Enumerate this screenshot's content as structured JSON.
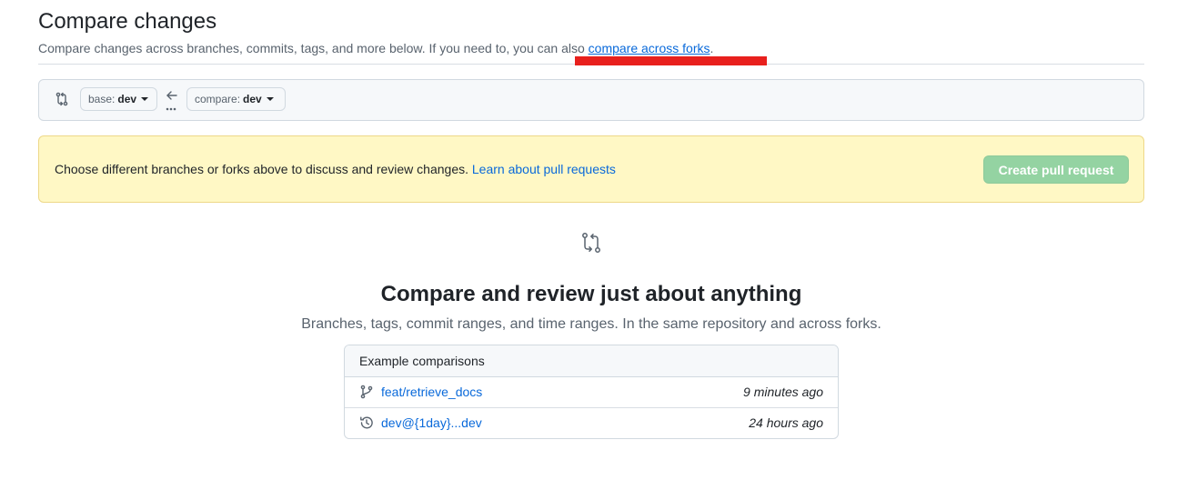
{
  "header": {
    "title": "Compare changes",
    "subtitle_prefix": "Compare changes across branches, commits, tags, and more below. If you need to, you can also ",
    "subtitle_link": "compare across forks",
    "subtitle_suffix": "."
  },
  "range": {
    "base_prefix": "base:",
    "base_value": "dev",
    "compare_prefix": "compare:",
    "compare_value": "dev",
    "arrow": "←",
    "dots": "..."
  },
  "flash": {
    "message": "Choose different branches or forks above to discuss and review changes. ",
    "link": "Learn about pull requests",
    "button": "Create pull request"
  },
  "blankslate": {
    "title": "Compare and review just about anything",
    "subtitle": "Branches, tags, commit ranges, and time ranges. In the same repository and across forks."
  },
  "examples": {
    "header": "Example comparisons",
    "rows": [
      {
        "icon": "git-branch-icon",
        "label": "feat/retrieve_docs",
        "time": "9 minutes ago"
      },
      {
        "icon": "history-icon",
        "label": "dev@{1day}...dev",
        "time": "24 hours ago"
      }
    ]
  },
  "colors": {
    "link": "#0969da",
    "flash_bg": "#fff8c5",
    "disabled_button": "#94d3a2",
    "annotation": "#e8201d"
  }
}
